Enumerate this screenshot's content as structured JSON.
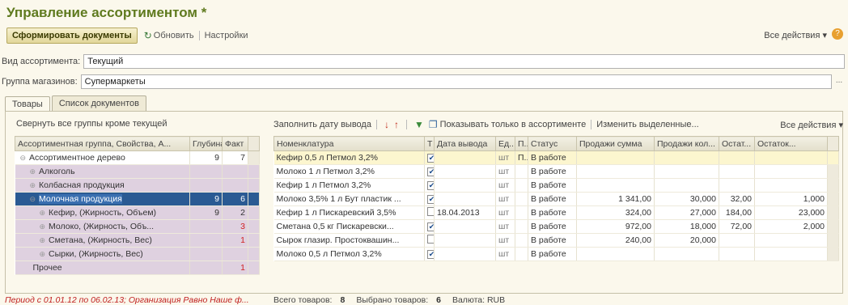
{
  "title": "Управление ассортиментом *",
  "toolbar": {
    "form_docs": "Сформировать документы",
    "refresh": "Обновить",
    "settings": "Настройки",
    "all_actions": "Все действия ▾",
    "help": "?"
  },
  "fields": {
    "assortment_kind_label": "Вид ассортимента:",
    "assortment_kind_value": "Текущий",
    "store_group_label": "Группа магазинов:",
    "store_group_value": "Супермаркеты",
    "store_group_btn": "..."
  },
  "tabs": [
    "Товары",
    "Список документов"
  ],
  "left": {
    "collapse_link": "Свернуть все группы кроме текущей",
    "headers": [
      "Ассортиментная группа, Свойства, А...",
      "Глубина",
      "Факт"
    ],
    "rows": [
      {
        "label": "Ассортиментное дерево",
        "depth": "9",
        "fact": "7",
        "indent": 0,
        "style": "white",
        "mark": "⊖",
        "fact_red": false
      },
      {
        "label": "Алкоголь",
        "depth": "",
        "fact": "",
        "indent": 1,
        "style": "purple",
        "mark": "⊕",
        "fact_red": false
      },
      {
        "label": "Колбасная продукция",
        "depth": "",
        "fact": "",
        "indent": 1,
        "style": "purple",
        "mark": "⊕",
        "fact_red": false
      },
      {
        "label": "Молочная продукция",
        "depth": "9",
        "fact": "6",
        "indent": 1,
        "style": "sel",
        "mark": "⊖",
        "fact_red": false
      },
      {
        "label": "Кефир, (Жирность, Объем)",
        "depth": "9",
        "fact": "2",
        "indent": 2,
        "style": "purple",
        "mark": "⊕",
        "fact_red": false
      },
      {
        "label": "Молоко, (Жирность, Объ...",
        "depth": "",
        "fact": "3",
        "indent": 2,
        "style": "purple",
        "mark": "⊕",
        "fact_red": true
      },
      {
        "label": "Сметана, (Жирность, Вес)",
        "depth": "",
        "fact": "1",
        "indent": 2,
        "style": "purple",
        "mark": "⊕",
        "fact_red": true
      },
      {
        "label": "Сырки, (Жирность, Вес)",
        "depth": "",
        "fact": "",
        "indent": 2,
        "style": "purple",
        "mark": "⊕",
        "fact_red": false
      },
      {
        "label": "Прочее",
        "depth": "",
        "fact": "1",
        "indent": 1,
        "style": "purple",
        "mark": "",
        "fact_red": true
      }
    ]
  },
  "right": {
    "toolbar": {
      "fill_date": "Заполнить дату вывода",
      "show_only": "Показывать только в ассортименте",
      "change_selected": "Изменить выделенные...",
      "all_actions": "Все действия ▾"
    },
    "headers": [
      "Номенклатура",
      "Т",
      "Дата вывода",
      "Ед...",
      "П...",
      "Статус",
      "Продажи сумма",
      "Продажи кол...",
      "Остат...",
      "Остаток..."
    ],
    "rows": [
      {
        "name": "Кефир 0,5 л  Петмол 3,2%",
        "t": true,
        "date": "",
        "unit": "шт",
        "p": "П...",
        "status": "В работе",
        "sum": "",
        "qty": "",
        "rest": "",
        "rest2": "",
        "sel": true
      },
      {
        "name": "Молоко 1 л  Петмол 3,2%",
        "t": true,
        "date": "",
        "unit": "шт",
        "p": "",
        "status": "В работе",
        "sum": "",
        "qty": "",
        "rest": "",
        "rest2": "",
        "sel": false
      },
      {
        "name": "Кефир 1 л  Петмол 3,2%",
        "t": true,
        "date": "",
        "unit": "шт",
        "p": "",
        "status": "В работе",
        "sum": "",
        "qty": "",
        "rest": "",
        "rest2": "",
        "sel": false
      },
      {
        "name": "Молоко 3,5% 1 л Бут пластик ...",
        "t": true,
        "date": "",
        "unit": "шт",
        "p": "",
        "status": "В работе",
        "sum": "1 341,00",
        "qty": "30,000",
        "rest": "32,00",
        "rest2": "1,000",
        "sel": false
      },
      {
        "name": "Кефир 1 л  Пискаревский 3,5%",
        "t": false,
        "date": "18.04.2013",
        "unit": "шт",
        "p": "",
        "status": "В работе",
        "sum": "324,00",
        "qty": "27,000",
        "rest": "184,00",
        "rest2": "23,000",
        "sel": false
      },
      {
        "name": "Сметана 0,5 кг  Пискаревски...",
        "t": true,
        "date": "",
        "unit": "шт",
        "p": "",
        "status": "В работе",
        "sum": "972,00",
        "qty": "18,000",
        "rest": "72,00",
        "rest2": "2,000",
        "sel": false
      },
      {
        "name": "Сырок глазир.  Простоквашин...",
        "t": false,
        "date": "",
        "unit": "шт",
        "p": "",
        "status": "В работе",
        "sum": "240,00",
        "qty": "20,000",
        "rest": "",
        "rest2": "",
        "sel": false
      },
      {
        "name": "Молоко 0,5 л  Петмол 3,2%",
        "t": true,
        "date": "",
        "unit": "шт",
        "p": "",
        "status": "В работе",
        "sum": "",
        "qty": "",
        "rest": "",
        "rest2": "",
        "sel": false
      }
    ]
  },
  "status": {
    "period": "Период с 01.01.12 по 06.02.13; Организация Равно Наше ф...",
    "total_label": "Всего товаров:",
    "total_value": "8",
    "selected_label": "Выбрано товаров:",
    "selected_value": "6",
    "currency": "Валюта: RUB"
  }
}
